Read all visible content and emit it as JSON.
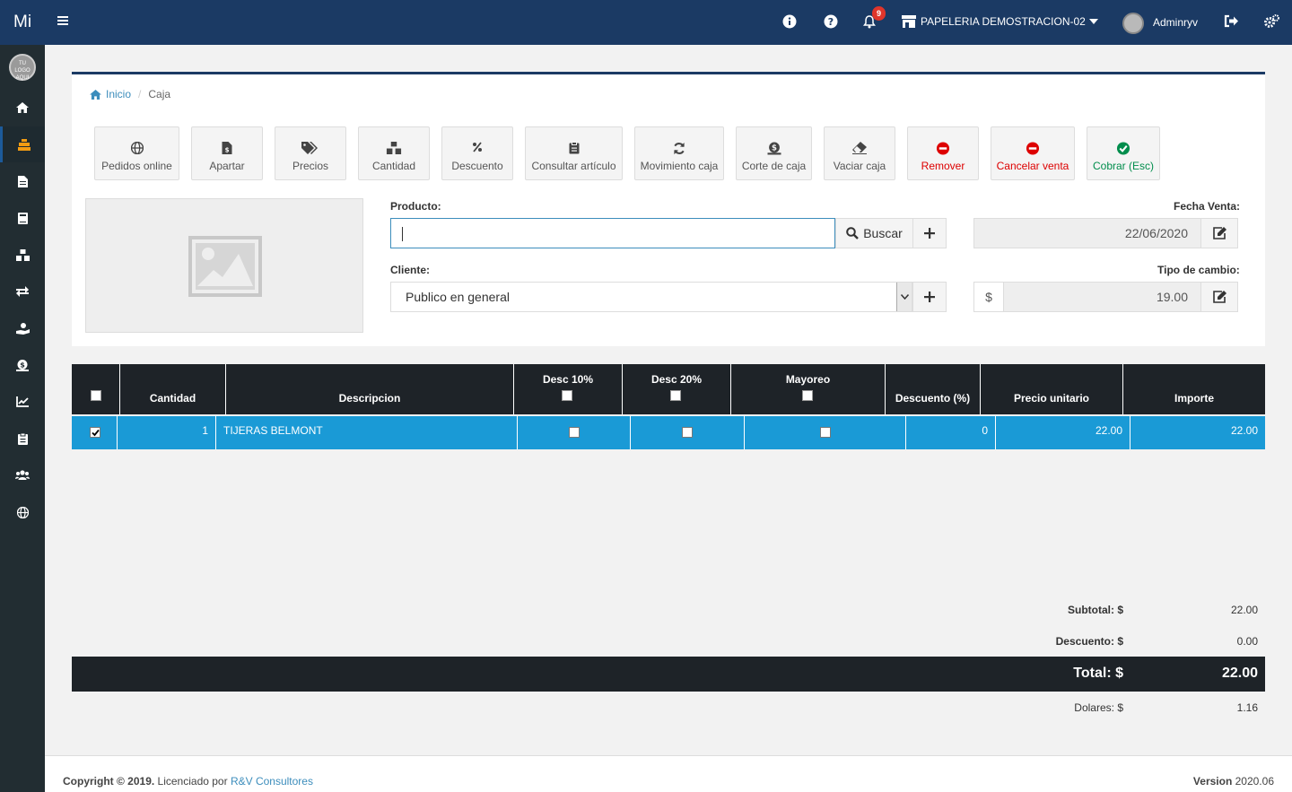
{
  "header": {
    "brand": "Mi",
    "notification_count": "9",
    "store_name": "PAPELERIA DEMOSTRACION-02",
    "user_name": "Adminryv"
  },
  "sidebar": {
    "logo_text": "TU LOGO AQUI",
    "items": [
      "home-icon",
      "cash-register-icon",
      "file-invoice-icon",
      "book-icon",
      "cubes-icon",
      "exchange-icon",
      "hand-coin-icon",
      "money-icon",
      "chart-line-icon",
      "clipboard-icon",
      "users-icon",
      "globe-icon"
    ]
  },
  "breadcrumb": {
    "home": "Inicio",
    "current": "Caja"
  },
  "toolbar": {
    "pedidos": "Pedidos online",
    "apartar": "Apartar",
    "precios": "Precios",
    "cantidad": "Cantidad",
    "descuento": "Descuento",
    "consultar": "Consultar artículo",
    "movimiento": "Movimiento caja",
    "corte": "Corte de caja",
    "vaciar": "Vaciar caja",
    "remover": "Remover",
    "cancelar": "Cancelar venta",
    "cobrar": "Cobrar (Esc)"
  },
  "form": {
    "producto_label": "Producto:",
    "producto_value": "",
    "buscar_label": "Buscar",
    "cliente_label": "Cliente:",
    "cliente_value": "Publico en general",
    "fecha_label": "Fecha Venta:",
    "fecha_value": "22/06/2020",
    "tipo_label": "Tipo de cambio:",
    "currency_symbol": "$",
    "tipo_value": "19.00"
  },
  "table": {
    "headers": {
      "cantidad": "Cantidad",
      "descripcion": "Descripcion",
      "desc10": "Desc 10%",
      "desc20": "Desc 20%",
      "mayoreo": "Mayoreo",
      "descuento": "Descuento (%)",
      "precio": "Precio unitario",
      "importe": "Importe"
    },
    "rows": [
      {
        "checked": true,
        "cantidad": "1",
        "descripcion": "TIJERAS BELMONT",
        "desc10": false,
        "desc20": false,
        "mayoreo": false,
        "descuento": "0",
        "precio": "22.00",
        "importe": "22.00"
      }
    ]
  },
  "summary": {
    "subtotal_label": "Subtotal: $",
    "subtotal_value": "22.00",
    "descuento_label": "Descuento: $",
    "descuento_value": "0.00",
    "total_label": "Total: $",
    "total_value": "22.00",
    "dolares_label": "Dolares: $",
    "dolares_value": "1.16"
  },
  "footer": {
    "copyright": "Copyright © 2019.",
    "licensed": " Licenciado por ",
    "company": "R&V Consultores",
    "version_label": "Version",
    "version": " 2020.06"
  }
}
